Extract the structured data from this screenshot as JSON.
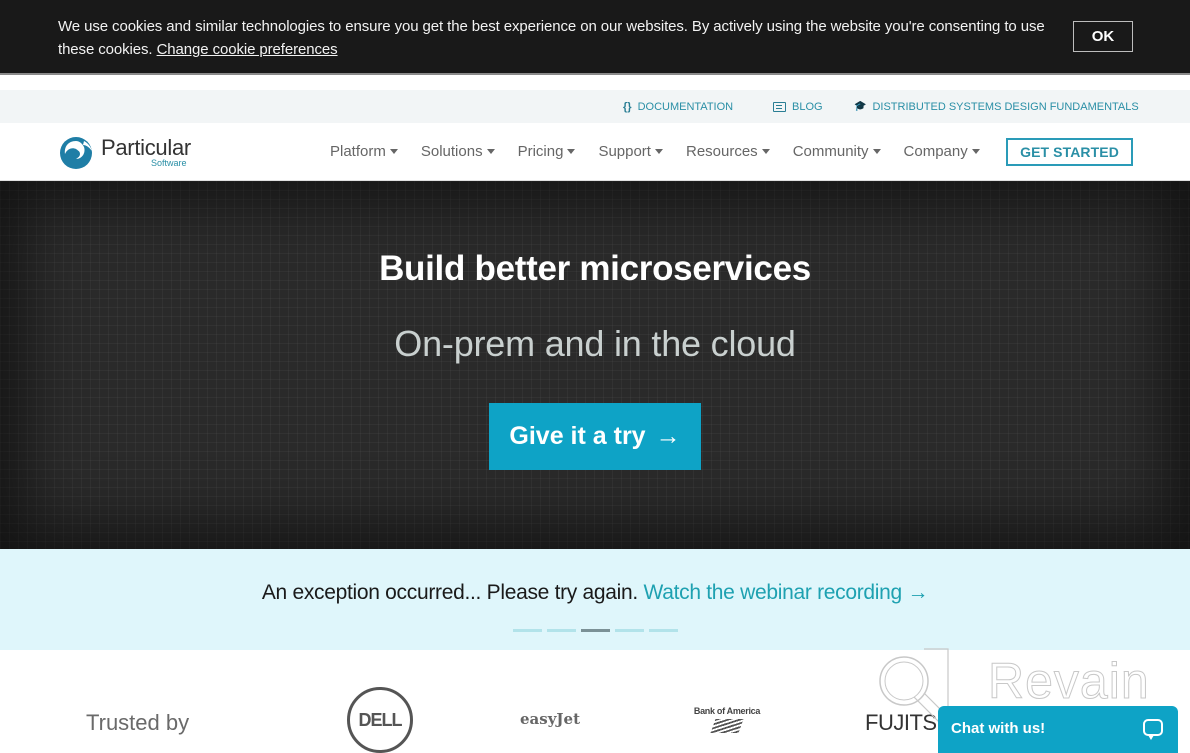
{
  "cookie_banner": {
    "message": "We use cookies and similar technologies to ensure you get the best experience on our websites. By actively using the website you're consenting to use these cookies.",
    "preferences_link": "Change cookie preferences",
    "ok_label": "OK"
  },
  "utility_nav": {
    "items": [
      {
        "icon": "code-braces-icon",
        "glyph": "{}",
        "label": "DOCUMENTATION"
      },
      {
        "icon": "blog-icon",
        "glyph": "",
        "label": "BLOG"
      },
      {
        "icon": "graduation-cap-icon",
        "glyph": "🎓",
        "label": "DISTRIBUTED SYSTEMS DESIGN FUNDAMENTALS"
      }
    ]
  },
  "header": {
    "logo_name": "Particular",
    "logo_sub": "Software",
    "nav": [
      {
        "label": "Platform"
      },
      {
        "label": "Solutions"
      },
      {
        "label": "Pricing"
      },
      {
        "label": "Support"
      },
      {
        "label": "Resources"
      },
      {
        "label": "Community"
      },
      {
        "label": "Company"
      }
    ],
    "cta_label": "GET STARTED"
  },
  "hero": {
    "title": "Build better microservices",
    "subtitle": "On-prem and in the cloud",
    "button_label": "Give it a try",
    "button_arrow": "→"
  },
  "announcement": {
    "text": "An exception occurred... Please try again.",
    "link": "Watch the webinar recording",
    "arrow": "→",
    "slides_total": 5,
    "active_slide": 3
  },
  "trusted": {
    "label": "Trusted by",
    "logos": [
      "DELL",
      "easyJet",
      "Bank of America",
      "FUJITSU"
    ]
  },
  "watermark": "Revain",
  "chat": {
    "label": "Chat with us!"
  },
  "colors": {
    "brand_teal": "#0ea3c6",
    "link_teal": "#1ea1b1",
    "banner_bg": "#191919",
    "announce_bg": "#dff6fb"
  }
}
